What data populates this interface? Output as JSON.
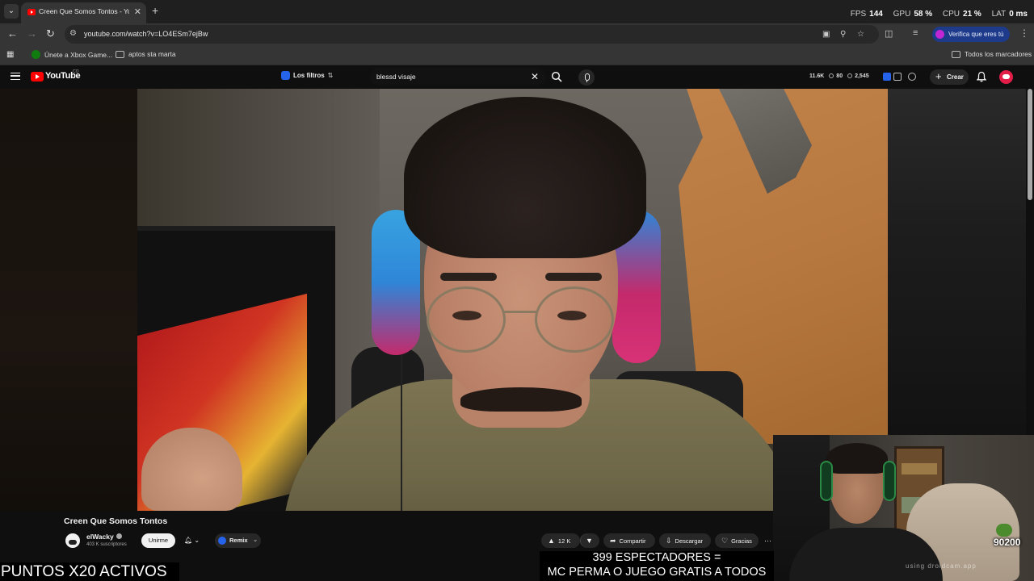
{
  "browser": {
    "tab_title": "Creen Que Somos Tontos - You",
    "url": "youtube.com/watch?v=LO4ESm7ejBw",
    "perf": {
      "fps_label": "FPS",
      "fps_value": "144",
      "gpu_label": "GPU",
      "gpu_value": "58 %",
      "cpu_label": "CPU",
      "cpu_value": "21 %",
      "lat_label": "LAT",
      "lat_value": "0 ms"
    },
    "verify_label": "Verifica que eres tú",
    "bookmarks": [
      "Únete a Xbox Game...",
      "aptos sta marta"
    ],
    "all_bookmarks": "Todos los marcadores"
  },
  "youtube": {
    "logo_text": "YouTube",
    "logo_country": "CO",
    "filters_label": "Los filtros",
    "search_value": "blessd visaje",
    "stats": {
      "a": "11.6K",
      "b": "80",
      "c": "2,545"
    },
    "create_label": "Crear"
  },
  "video": {
    "title": "Creen Que Somos Tontos",
    "channel": "elWacky",
    "subscribers": "403 K suscriptores",
    "join_label": "Unirme",
    "remix_label": "Remix",
    "likes": "12 K",
    "share_label": "Compartir",
    "download_label": "Descargar",
    "thanks_label": "Gracias"
  },
  "stream_overlay": {
    "points_banner": "PUNTOS X20 ACTIVOS",
    "viewers_line1": "399 ESPECTADORES =",
    "viewers_line2": "MC PERMA O JUEGO GRATIS A TODOS",
    "facecam_watermark": "using droidcam.app",
    "channel_points": "90200"
  },
  "colors": {
    "brand_red": "#ff0000",
    "accent_blue": "#2563eb",
    "background": "#0f0f0f"
  }
}
